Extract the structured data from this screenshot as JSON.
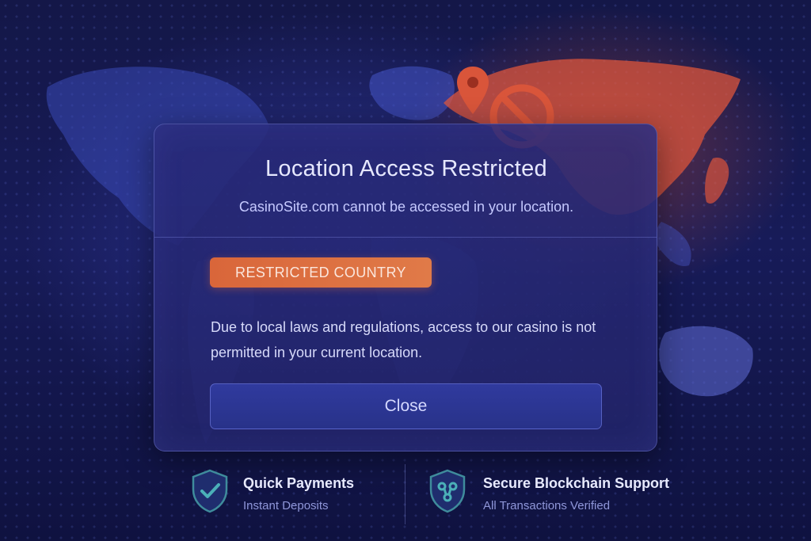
{
  "dialog": {
    "title": "Location Access Restricted",
    "subtitle": "CasinoSite.com cannot be accessed in your location.",
    "badge": "RESTRICTED COUNTRY",
    "message": "Due to local laws and regulations, access to our casino is not permitted in your current location.",
    "close_label": "Close"
  },
  "features": [
    {
      "title": "Quick Payments",
      "subtitle": "Instant Deposits",
      "icon": "shield-check-icon"
    },
    {
      "title": "Secure Blockchain Support",
      "subtitle": "All Transactions Verified",
      "icon": "shield-blockchain-icon"
    }
  ],
  "icons": {
    "location": "location-pin-icon",
    "blocked": "prohibited-icon"
  },
  "colors": {
    "background": "#141748",
    "dialog": "#2a2c7a",
    "badge": "#dc6e40",
    "button": "#2c3693",
    "restricted_region": "#e8583a",
    "world_map": "#3a48b8"
  }
}
